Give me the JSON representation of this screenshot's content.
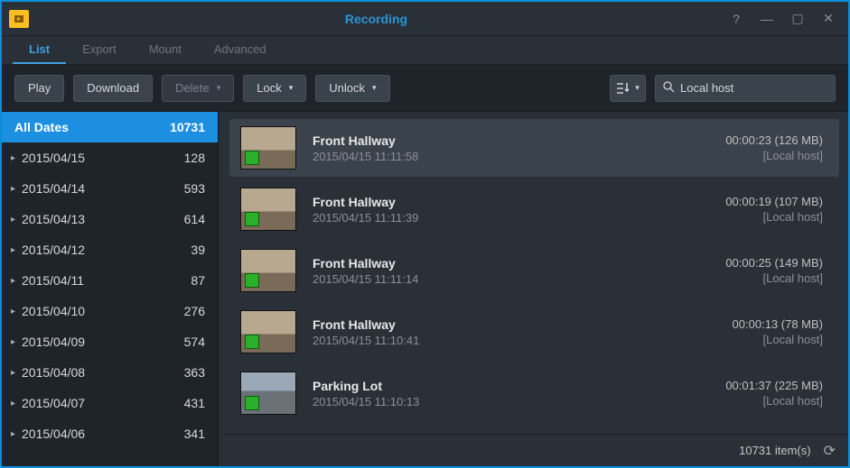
{
  "window": {
    "title": "Recording"
  },
  "tabs": [
    {
      "label": "List",
      "active": true
    },
    {
      "label": "Export",
      "active": false
    },
    {
      "label": "Mount",
      "active": false
    },
    {
      "label": "Advanced",
      "active": false
    }
  ],
  "toolbar": {
    "play": "Play",
    "download": "Download",
    "delete": "Delete",
    "lock": "Lock",
    "unlock": "Unlock"
  },
  "search": {
    "value": "Local host"
  },
  "sidebar": {
    "all_label": "All Dates",
    "all_count": "10731",
    "dates": [
      {
        "label": "2015/04/15",
        "count": "128"
      },
      {
        "label": "2015/04/14",
        "count": "593"
      },
      {
        "label": "2015/04/13",
        "count": "614"
      },
      {
        "label": "2015/04/12",
        "count": "39"
      },
      {
        "label": "2015/04/11",
        "count": "87"
      },
      {
        "label": "2015/04/10",
        "count": "276"
      },
      {
        "label": "2015/04/09",
        "count": "574"
      },
      {
        "label": "2015/04/08",
        "count": "363"
      },
      {
        "label": "2015/04/07",
        "count": "431"
      },
      {
        "label": "2015/04/06",
        "count": "341"
      }
    ]
  },
  "recordings": [
    {
      "name": "Front Hallway",
      "time": "2015/04/15 11:11:58",
      "duration": "00:00:23 (126 MB)",
      "host": "[Local host]",
      "thumb": "hall",
      "selected": true
    },
    {
      "name": "Front Hallway",
      "time": "2015/04/15 11:11:39",
      "duration": "00:00:19 (107 MB)",
      "host": "[Local host]",
      "thumb": "hall",
      "selected": false
    },
    {
      "name": "Front Hallway",
      "time": "2015/04/15 11:11:14",
      "duration": "00:00:25 (149 MB)",
      "host": "[Local host]",
      "thumb": "hall",
      "selected": false
    },
    {
      "name": "Front Hallway",
      "time": "2015/04/15 11:10:41",
      "duration": "00:00:13 (78 MB)",
      "host": "[Local host]",
      "thumb": "hall",
      "selected": false
    },
    {
      "name": "Parking Lot",
      "time": "2015/04/15 11:10:13",
      "duration": "00:01:37 (225 MB)",
      "host": "[Local host]",
      "thumb": "parking",
      "selected": false
    }
  ],
  "status": {
    "count_text": "10731 item(s)"
  }
}
